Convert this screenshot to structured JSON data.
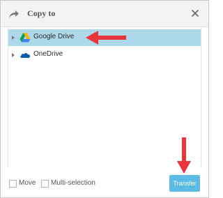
{
  "dialog": {
    "title": "Copy to",
    "title_icon": "share-arrow-icon",
    "close_icon": "close-icon"
  },
  "tree": {
    "items": [
      {
        "label": "Google Drive",
        "icon": "google-drive-icon",
        "selected": true
      },
      {
        "label": "OneDrive",
        "icon": "onedrive-icon",
        "selected": false
      }
    ]
  },
  "options": {
    "move_label": "Move",
    "move_checked": false,
    "multi_label": "Multi-selection",
    "multi_checked": false
  },
  "footer": {
    "transfer_label": "Transfer"
  },
  "colors": {
    "selection": "#add8ea",
    "button": "#5bbbe5",
    "annotation_arrow": "#e8343a"
  }
}
